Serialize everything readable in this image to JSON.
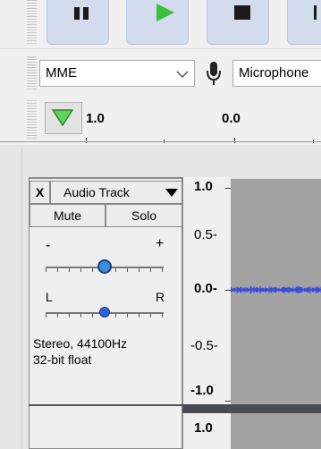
{
  "transport": {
    "buttons": [
      {
        "name": "pause-button",
        "icon": "pause-icon"
      },
      {
        "name": "play-button",
        "icon": "play-icon"
      },
      {
        "name": "stop-button",
        "icon": "stop-icon"
      },
      {
        "name": "skip-to-start-button",
        "icon": "skip-icon"
      }
    ]
  },
  "device": {
    "host": "MME",
    "recording_device": "Microphone",
    "mic_icon": "microphone-icon"
  },
  "ruler": {
    "play_head_icon": "play-head-triangle-icon",
    "labels": [
      "1.0",
      "0.0"
    ]
  },
  "track": {
    "name": "Audio Track",
    "close_label": "X",
    "mute_label": "Mute",
    "solo_label": "Solo",
    "gain_minus": "-",
    "gain_plus": "+",
    "gain_level": 0.5,
    "pan_left": "L",
    "pan_right": "R",
    "pan_level": 0.5,
    "info_line1": "Stereo, 44100Hz",
    "info_line2": "32-bit float",
    "waveform_color": "#3b4ed6"
  },
  "vertical_ruler": {
    "labels": [
      "1.0",
      "0.5-",
      "0.0-",
      "-0.5-",
      "-1.0"
    ],
    "second_channel_top": "1.0"
  },
  "colors": {
    "button_bg": "#d2dced",
    "play_green": "#3cbf3c",
    "wave_bg": "#a3a3a3",
    "pan_blue": "#2e63d8"
  }
}
